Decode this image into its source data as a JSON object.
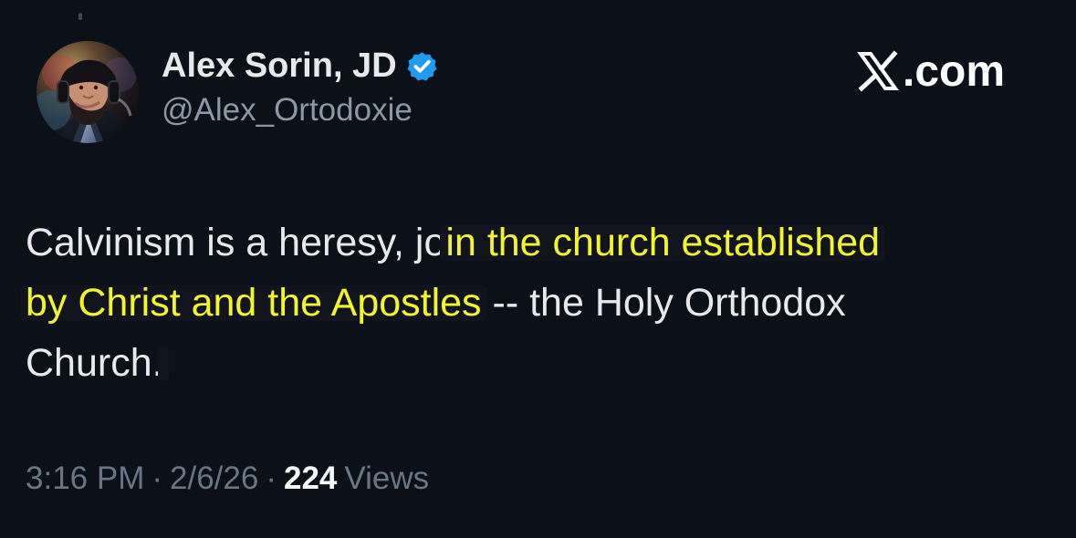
{
  "author": {
    "display_name": "Alex Sorin, JD",
    "handle": "@Alex_Ortodoxie"
  },
  "brand": {
    "domain_suffix": ".com"
  },
  "tweet": {
    "lines": [
      {
        "before": "Calvinism is a heresy, jo",
        "highlight": "in the church established",
        "after": ""
      },
      {
        "before": "",
        "highlight": "by Christ and the Apostles",
        "after": " -- the Holy Orthodox"
      },
      {
        "before": "Church.",
        "highlight": "",
        "after": ""
      }
    ]
  },
  "metadata": {
    "time": "3:16 PM",
    "separator": "·",
    "date": "2/6/26",
    "views_count": "224",
    "views_label": "Views"
  },
  "colors": {
    "background": "#0b1019",
    "primary_text": "#e7e9ea",
    "secondary_text": "#8b98a5",
    "highlight_text": "#f2f42f",
    "verified_badge": "#1d9bf0"
  },
  "icons": {
    "verified": "verified-badge-icon",
    "x_logo": "x-logo-icon",
    "avatar": "profile-photo"
  }
}
